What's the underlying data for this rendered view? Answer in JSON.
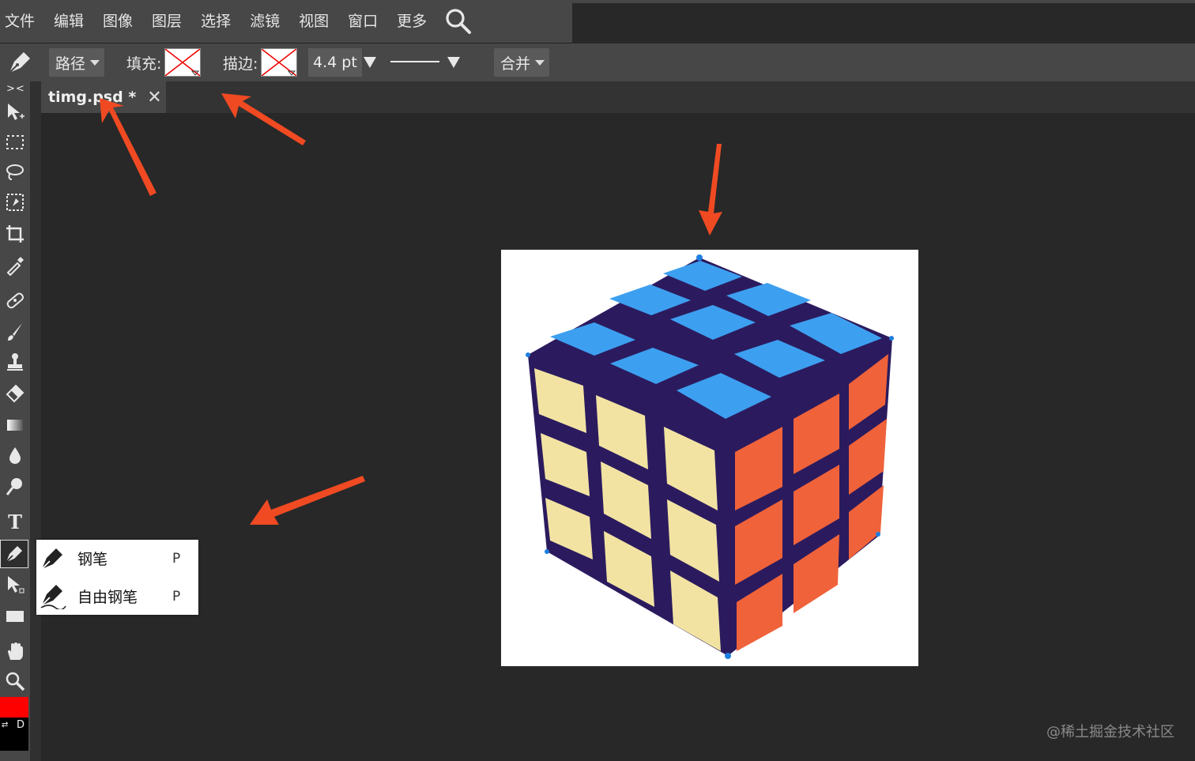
{
  "menubar": {
    "items": [
      "文件",
      "编辑",
      "图像",
      "图层",
      "选择",
      "滤镜",
      "视图",
      "窗口",
      "更多"
    ]
  },
  "options": {
    "mode": "路径",
    "fill_label": "填充:",
    "stroke_label": "描边:",
    "stroke_width": "4.4 pt",
    "combine": "合并"
  },
  "tabs": {
    "collapse": "><",
    "doc_title": "timg.psd *",
    "close": "✕"
  },
  "flyout": {
    "items": [
      {
        "label": "钢笔",
        "shortcut": "P"
      },
      {
        "label": "自由钢笔",
        "shortcut": "P"
      }
    ]
  },
  "colors": {
    "foreground": "#ff0000",
    "background": "#000000",
    "default_key": "D",
    "annotation_arrows": "#f04a23"
  },
  "watermark": "@稀土掘金技术社区"
}
